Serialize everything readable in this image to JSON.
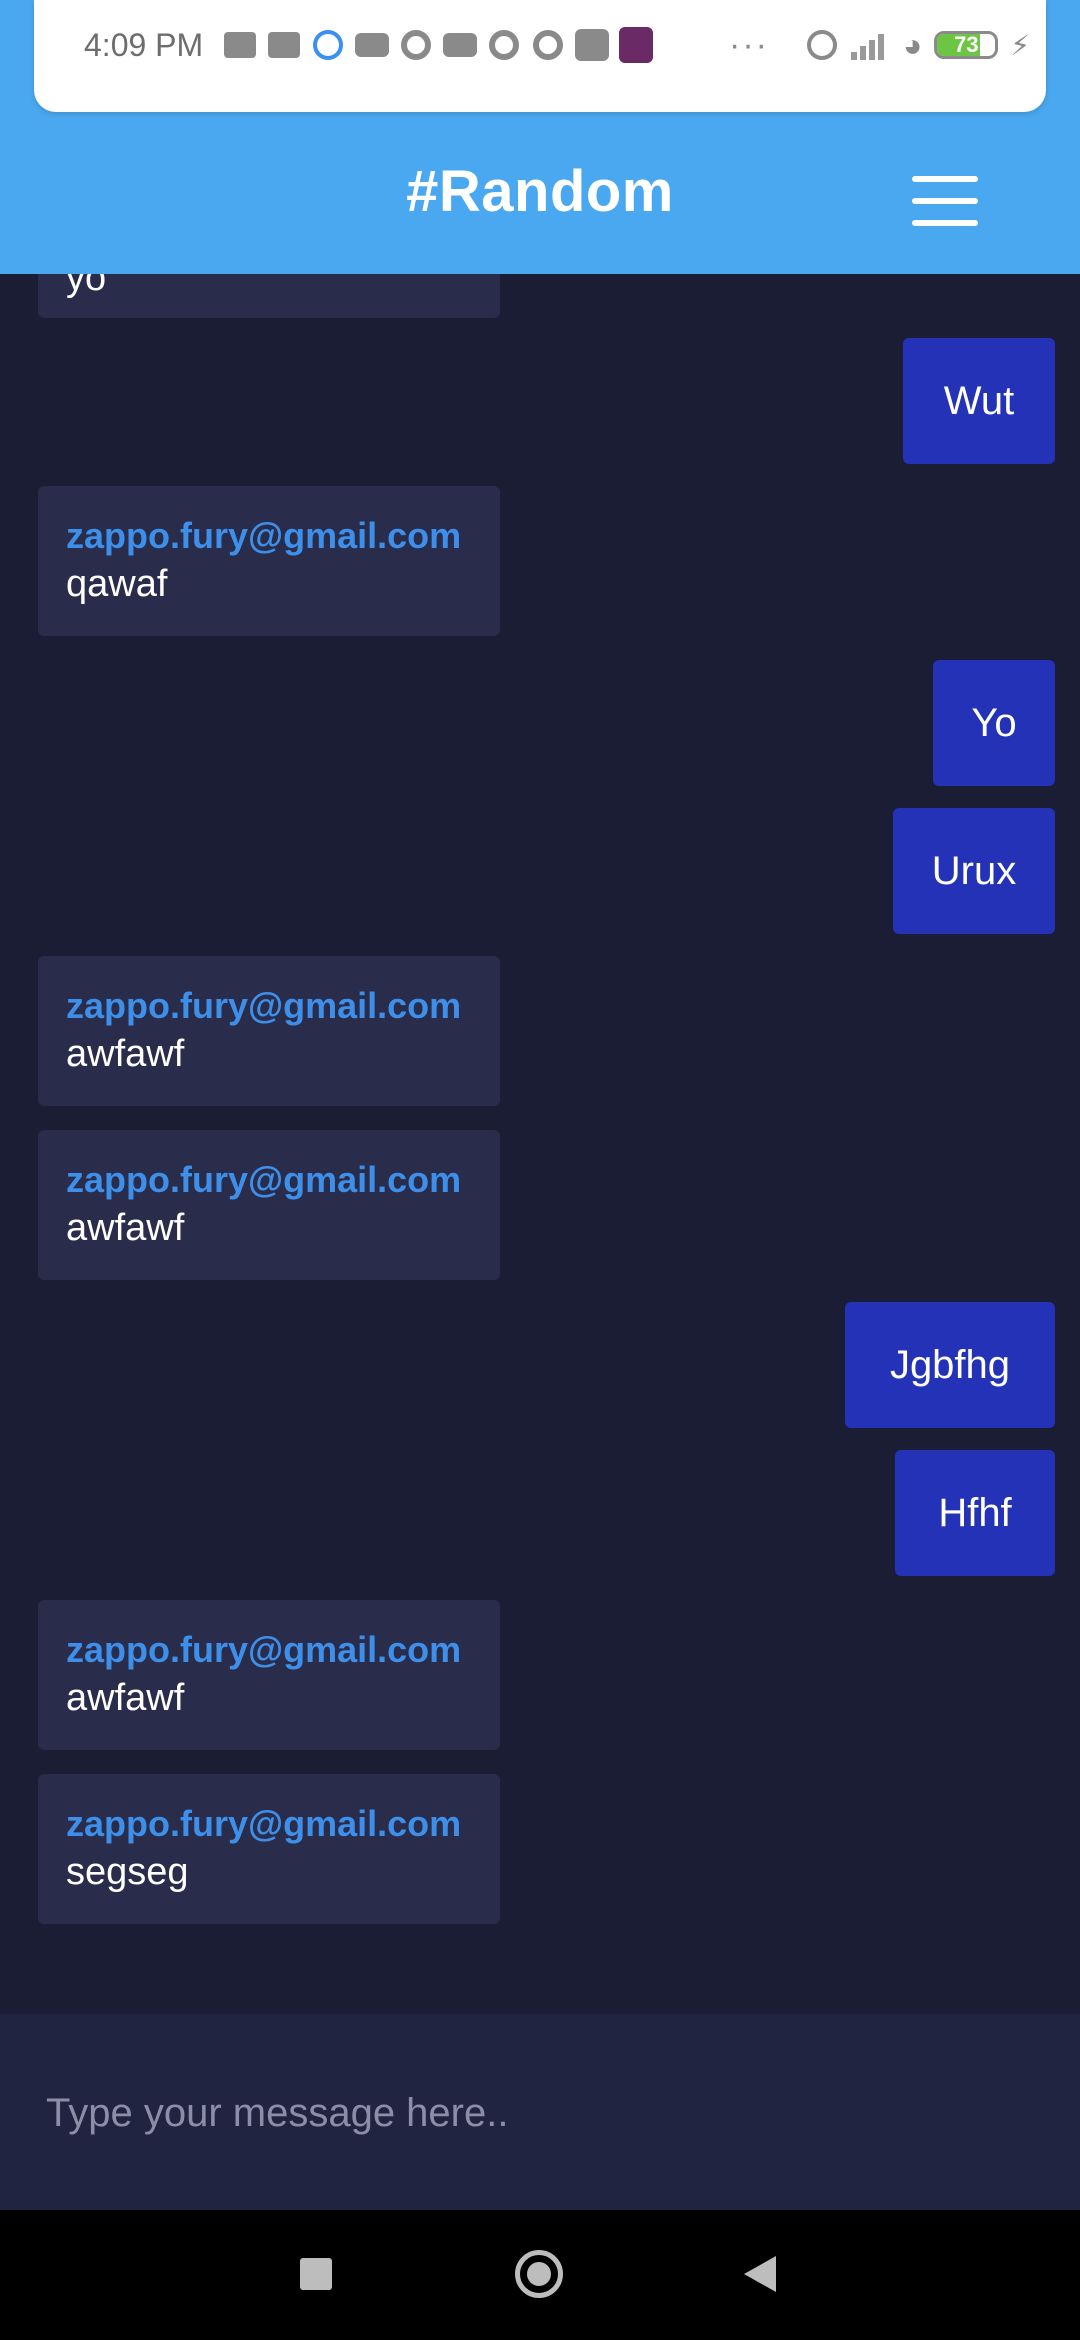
{
  "status_bar": {
    "time": "4:09 PM",
    "battery": "73",
    "battery_level": 0.73,
    "icons": [
      "message-icon",
      "message-icon",
      "whatsapp-icon",
      "youtube-icon",
      "circle-app-icon",
      "youtube-icon",
      "app-icon",
      "app-icon",
      "paytm-icon",
      "yono-icon",
      "more-dots-icon",
      "alarm-icon",
      "signal-icon",
      "wifi-icon",
      "battery-icon",
      "charging-icon"
    ]
  },
  "header": {
    "title": "#Random",
    "menu_icon": "hamburger-menu-icon"
  },
  "colors": {
    "header": "#4aa8f0",
    "background": "#1a1d33",
    "incoming_bubble": "#292c4a",
    "outgoing_bubble": "#2432b8",
    "sender_text": "#3e8fe9",
    "composer": "#212441"
  },
  "messages": [
    {
      "direction": "in",
      "sender": "",
      "text": "yo"
    },
    {
      "direction": "out",
      "text": "Wut"
    },
    {
      "direction": "in",
      "sender": "zappo.fury@gmail.com",
      "text": "qawaf"
    },
    {
      "direction": "out",
      "text": "Yo"
    },
    {
      "direction": "out",
      "text": "Urux"
    },
    {
      "direction": "in",
      "sender": "zappo.fury@gmail.com",
      "text": "awfawf"
    },
    {
      "direction": "in",
      "sender": "zappo.fury@gmail.com",
      "text": "awfawf"
    },
    {
      "direction": "out",
      "text": "Jgbfhg"
    },
    {
      "direction": "out",
      "text": "Hfhf"
    },
    {
      "direction": "in",
      "sender": "zappo.fury@gmail.com",
      "text": "awfawf"
    },
    {
      "direction": "in",
      "sender": "zappo.fury@gmail.com",
      "text": "segseg"
    }
  ],
  "composer": {
    "placeholder": "Type your message here..",
    "value": ""
  },
  "nav_bar": {
    "recent": "recent-apps-icon",
    "home": "home-icon",
    "back": "back-icon"
  }
}
